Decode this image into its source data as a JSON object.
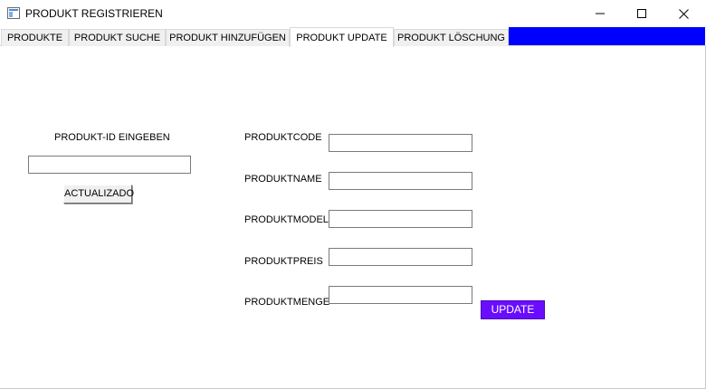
{
  "window": {
    "title": "PRODUKT REGISTRIEREN",
    "controls": {
      "minimize_icon": "minimize-icon",
      "maximize_icon": "maximize-icon",
      "close_icon": "close-icon"
    }
  },
  "tabs": [
    {
      "label": "PRODUKTE",
      "active": false
    },
    {
      "label": "PRODUKT SUCHE",
      "active": false
    },
    {
      "label": "PRODUKT HINZUFÜGEN",
      "active": false
    },
    {
      "label": "PRODUKT UPDATE",
      "active": true
    },
    {
      "label": "PRODUKT LÖSCHUNG",
      "active": false
    }
  ],
  "colors": {
    "tab_fill": "#0000ff",
    "update_button": "#6a0dff"
  },
  "lookup": {
    "label": "PRODUKT-ID EINGEBEN",
    "input_value": "",
    "button_label": "ACTUALIZADO"
  },
  "form": {
    "fields": [
      {
        "label": "PRODUKTCODE",
        "value": ""
      },
      {
        "label": "PRODUKTNAME",
        "value": ""
      },
      {
        "label": "PRODUKTMODELL",
        "value": ""
      },
      {
        "label": "PRODUKTPREIS",
        "value": ""
      },
      {
        "label": "PRODUKTMENGE",
        "value": ""
      }
    ],
    "submit_label": "UPDATE"
  }
}
